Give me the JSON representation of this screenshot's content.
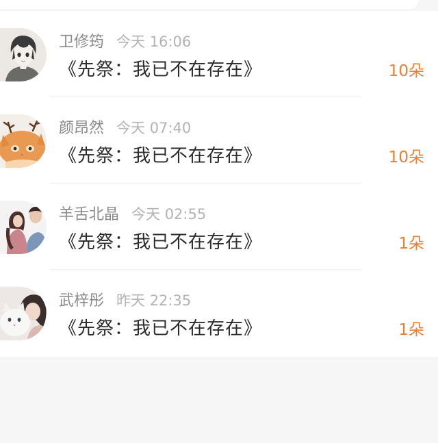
{
  "rows": [
    {
      "name": "卫修筠",
      "time": "今天 16:06",
      "title": "《先祭：我已不在存在》",
      "count": "10朵",
      "avatar_icon": "anime-boy-avatar-icon"
    },
    {
      "name": "颜昂然",
      "time": "今天 07:40",
      "title": "《先祭：我已不在存在》",
      "count": "10朵",
      "avatar_icon": "orange-cat-antlers-avatar-icon"
    },
    {
      "name": "羊舌北晶",
      "time": "今天 02:55",
      "title": "《先祭：我已不在存在》",
      "count": "1朵",
      "avatar_icon": "couple-photo-avatar-icon"
    },
    {
      "name": "武梓彤",
      "time": "昨天 22:35",
      "title": "《先祭：我已不在存在》",
      "count": "1朵",
      "avatar_icon": "girl-with-cat-avatar-icon"
    }
  ],
  "colors": {
    "accent": "#f07c2c",
    "name": "#8a8a8a",
    "time": "#b3b3b3",
    "title": "#2b2b2b",
    "background": "#f7f6f7"
  }
}
